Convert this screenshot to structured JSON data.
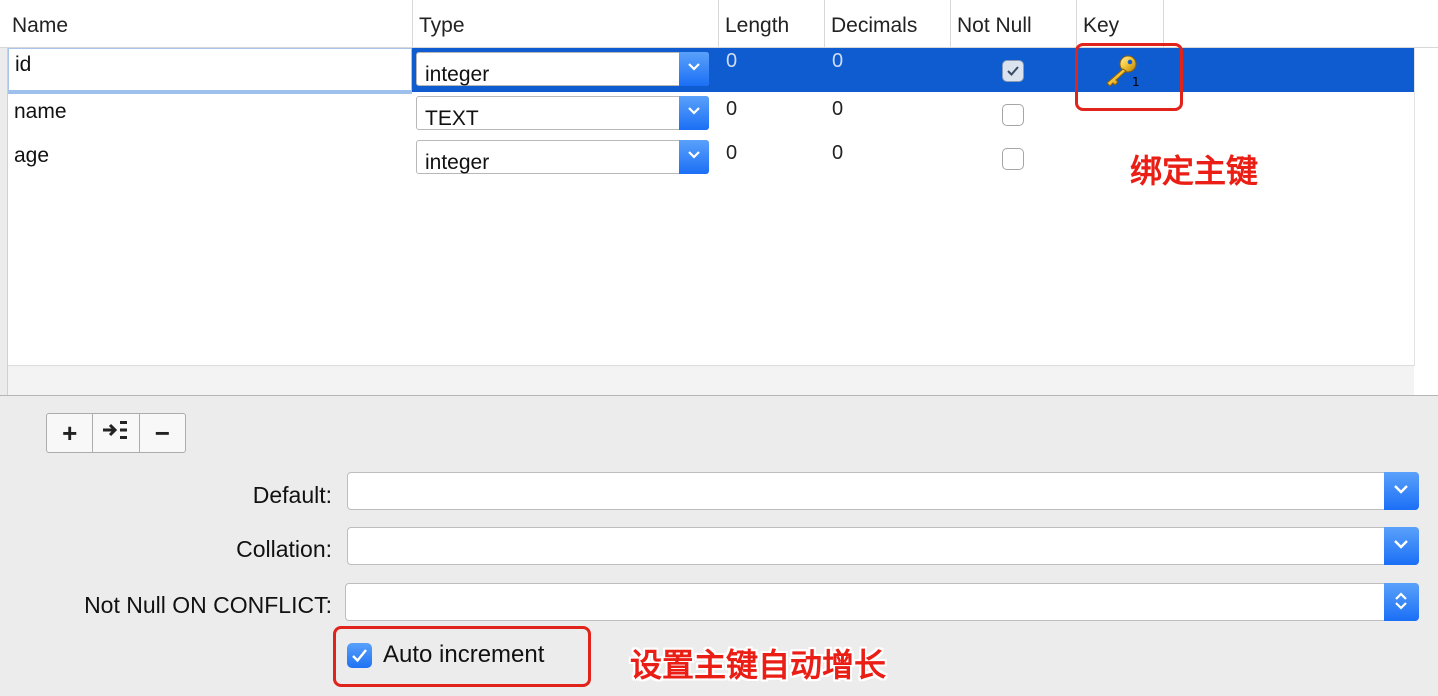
{
  "columns": [
    "Name",
    "Type",
    "Length",
    "Decimals",
    "Not Null",
    "Key"
  ],
  "rows": [
    {
      "name": "id",
      "type": "integer",
      "length": "0",
      "decimals": "0",
      "not_null": true,
      "key": true
    },
    {
      "name": "name",
      "type": "TEXT",
      "length": "0",
      "decimals": "0",
      "not_null": false,
      "key": false
    },
    {
      "name": "age",
      "type": "integer",
      "length": "0",
      "decimals": "0",
      "not_null": false,
      "key": false
    }
  ],
  "toolbar": {
    "add": "+",
    "insert": "+",
    "remove": "−"
  },
  "form": {
    "default_label": "Default:",
    "collation_label": "Collation:",
    "not_null_conflict_label": "Not Null ON CONFLICT:",
    "auto_increment_label": "Auto increment",
    "auto_increment_checked": true
  },
  "annotations": {
    "key_note": "绑定主键",
    "auto_inc_note": "设置主键自动增长"
  },
  "colors": {
    "selection": "#0f5bd0",
    "accent": "#1b6ff5",
    "annotation": "#e0231b"
  },
  "icons": [
    "key-icon",
    "chevron-down-icon",
    "up-down-chevron-icon",
    "checkmark-icon",
    "insert-row-icon"
  ]
}
